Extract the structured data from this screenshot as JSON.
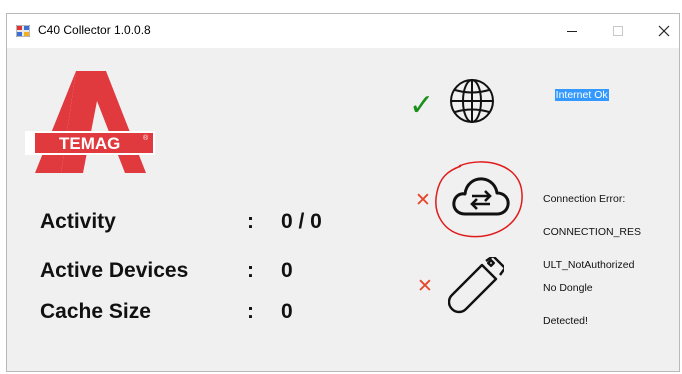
{
  "window": {
    "title": "C40 Collector 1.0.0.8",
    "controls": [
      "minimize",
      "maximize",
      "close"
    ]
  },
  "logo": {
    "text": "TEMAG",
    "letter": "A",
    "mark": "®",
    "color": "#e0393e"
  },
  "stats": [
    {
      "label": "Activity",
      "colon": ":",
      "value": "0 / 0"
    },
    {
      "label": "Active Devices",
      "colon": ":",
      "value": "0"
    },
    {
      "label": "Cache Size",
      "colon": ":",
      "value": "0"
    }
  ],
  "status": {
    "internet": {
      "icon": "globe-icon",
      "mark": "✓",
      "mark_color": "#1a8f1a",
      "text": "Internet Ok",
      "highlight": "#3399ff"
    },
    "connection": {
      "icon": "cloud-sync-icon",
      "mark": "✕",
      "mark_color": "#e8462c",
      "lines": [
        "Connection Error:",
        "CONNECTION_RES",
        "ULT_NotAuthorized"
      ],
      "annotation_color": "#e01b1b"
    },
    "dongle": {
      "icon": "usb-stick-icon",
      "mark": "✕",
      "mark_color": "#e8462c",
      "lines": [
        "No Dongle",
        "Detected!"
      ]
    }
  }
}
